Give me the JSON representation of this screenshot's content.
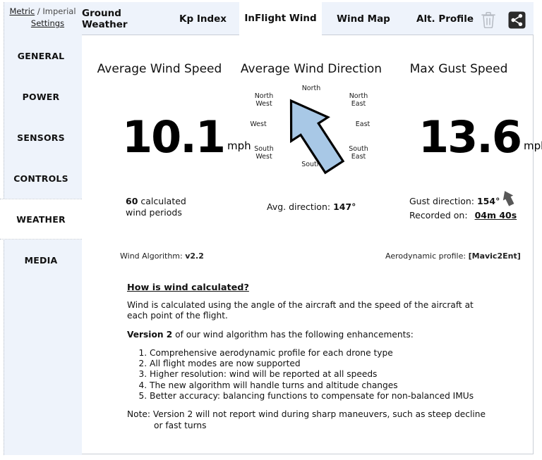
{
  "units": {
    "metric_label": "Metric",
    "separator": "/",
    "imperial_label": "Imperial",
    "settings_label": "Settings"
  },
  "sidebar": {
    "items": [
      {
        "label": "GENERAL",
        "active": false
      },
      {
        "label": "POWER",
        "active": false
      },
      {
        "label": "SENSORS",
        "active": false
      },
      {
        "label": "CONTROLS",
        "active": false
      },
      {
        "label": "WEATHER",
        "active": true
      },
      {
        "label": "MEDIA",
        "active": false
      }
    ]
  },
  "tabs": {
    "items": [
      {
        "label": "Ground Weather",
        "active": false
      },
      {
        "label": "Kp Index",
        "active": false
      },
      {
        "label": "InFlight Wind",
        "active": true
      },
      {
        "label": "Wind Map",
        "active": false
      },
      {
        "label": "Alt. Profile",
        "active": false
      }
    ],
    "icons": [
      {
        "name": "trash-icon"
      },
      {
        "name": "share-icon"
      }
    ]
  },
  "main": {
    "avg_wind_speed": {
      "title": "Average Wind Speed",
      "value": "10.1",
      "unit": "mph"
    },
    "avg_wind_direction": {
      "title": "Average Wind Direction",
      "compass_labels": {
        "north": "North",
        "north_east_line1": "North",
        "north_east_line2": "East",
        "east": "East",
        "south_east_line1": "South",
        "south_east_line2": "East",
        "south": "South",
        "south_west_line1": "South",
        "south_west_line2": "West",
        "west": "West",
        "north_west_line1": "North",
        "north_west_line2": "West"
      },
      "arrow_heading_deg": 327,
      "arrow_fill": "#a8c8e6",
      "arrow_stroke": "#000000"
    },
    "max_gust_speed": {
      "title": "Max Gust Speed",
      "value": "13.6",
      "unit": "mph"
    },
    "stats": {
      "periods_value": "60",
      "periods_label_line1": "calculated",
      "periods_label_line2": "wind periods",
      "avg_direction_label": "Avg. direction:",
      "avg_direction_value": "147°",
      "gust_direction_label": "Gust direction:",
      "gust_direction_value": "154°",
      "gust_arrow_heading_deg": 334,
      "recorded_on_label": "Recorded on:",
      "recorded_on_value": "04m 40s"
    },
    "meta": {
      "algorithm_label": "Wind Algorithm:",
      "algorithm_value": "v2.2",
      "profile_label": "Aerodynamic profile:",
      "profile_value": "[Mavic2Ent]"
    },
    "article": {
      "heading": "How is wind calculated?",
      "paragraph": "Wind is calculated using the angle of the aircraft and the speed of the aircraft at each point of the flight.",
      "version_bold": "Version 2",
      "version_rest": " of our wind algorithm has the following enhancements:",
      "enhancements": [
        "Comprehensive aerodynamic profile for each drone type",
        "All flight modes are now supported",
        "Higher resolution: wind will be reported at all speeds",
        "The new algorithm will handle turns and altitude changes",
        "Better accuracy: balancing functions to compensate for non-balanced IMUs"
      ],
      "note": "Note: Version 2 will not report wind during sharp maneuvers, such as steep decline or fast turns"
    }
  }
}
